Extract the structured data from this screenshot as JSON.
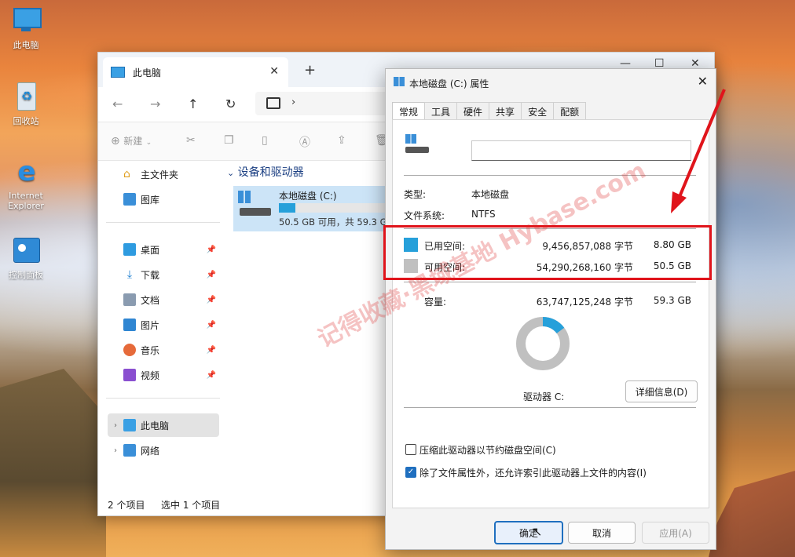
{
  "desktop": {
    "icons": [
      {
        "label": "此电脑"
      },
      {
        "label": "回收站"
      },
      {
        "label": "Internet Explorer"
      },
      {
        "label": "控制面板"
      }
    ]
  },
  "explorer": {
    "tab_title": "此电脑",
    "toolbar": {
      "new_label": "新建"
    },
    "nav": {
      "home": "主文件夹",
      "gallery": "图库",
      "desktop": "桌面",
      "downloads": "下载",
      "documents": "文档",
      "pictures": "图片",
      "music": "音乐",
      "videos": "视频",
      "this_pc": "此电脑",
      "network": "网络"
    },
    "group_header": "设备和驱动器",
    "drive": {
      "name": "本地磁盘 (C:)",
      "free_text": "50.5 GB 可用，共 59.3 G",
      "used_fraction": 0.148
    },
    "status": {
      "count": "2 个项目",
      "selected": "选中 1 个项目"
    }
  },
  "dialog": {
    "title": "本地磁盘 (C:) 属性",
    "tabs": [
      "常规",
      "工具",
      "硬件",
      "共享",
      "安全",
      "配额"
    ],
    "type_label": "类型:",
    "type_value": "本地磁盘",
    "fs_label": "文件系统:",
    "fs_value": "NTFS",
    "used_label": "已用空间:",
    "used_bytes": "9,456,857,088 字节",
    "used_gb": "8.80 GB",
    "free_label": "可用空间:",
    "free_bytes": "54,290,268,160 字节",
    "free_gb": "50.5 GB",
    "cap_label": "容量:",
    "cap_bytes": "63,747,125,248 字节",
    "cap_gb": "59.3 GB",
    "drive_label": "驱动器 C:",
    "details_button": "详细信息(D)",
    "compress_label": "压缩此驱动器以节约磁盘空间(C)",
    "index_label": "除了文件属性外，还允许索引此驱动器上文件的内容(I)",
    "ok": "确定",
    "cancel": "取消",
    "apply": "应用(A)",
    "used_fraction": 0.148,
    "colors": {
      "used": "#26a0da",
      "free": "#c0c0c0"
    }
  },
  "watermark": "记得收藏·黑域基地 Hybase.com"
}
